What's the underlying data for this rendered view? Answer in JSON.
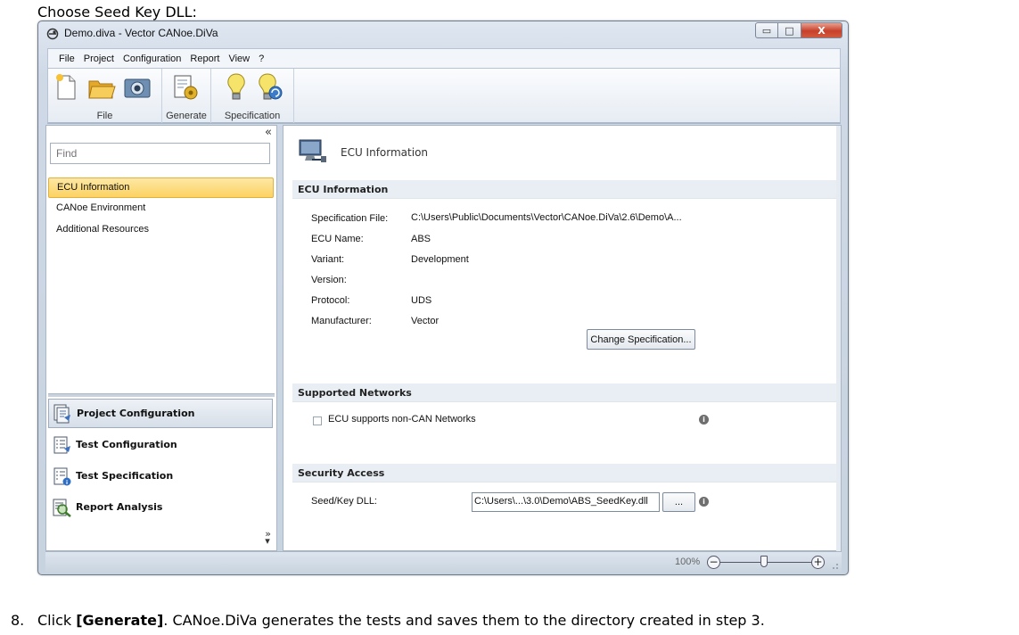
{
  "doc": {
    "heading": "Choose Seed Key DLL:",
    "step_number": "8.",
    "step_prefix": "Click ",
    "step_bold": "[Generate]",
    "step_suffix": ". CANoe.DiVa generates the tests and saves them to the directory created in step 3."
  },
  "window": {
    "title": "Demo.diva - Vector CANoe.DiVa",
    "close_glyph": "X",
    "min_glyph": "▭",
    "max_glyph": "□"
  },
  "menu": [
    "File",
    "Project",
    "Configuration",
    "Report",
    "View",
    "?"
  ],
  "ribbon": {
    "groups": [
      {
        "label": "File",
        "buttons": [
          "new-icon",
          "open-folder-icon",
          "save-camera-icon"
        ]
      },
      {
        "label": "Generate",
        "buttons": [
          "generate-icon"
        ]
      },
      {
        "label": "Specification",
        "buttons": [
          "lightbulb-icon",
          "lightbulb-refresh-icon"
        ]
      }
    ]
  },
  "left_pane": {
    "collapse_glyph": "«",
    "find_placeholder": "Find",
    "nav_items": [
      "ECU Information",
      "CANoe Environment",
      "Additional Resources"
    ],
    "selected_index": 0,
    "sections": [
      "Project Configuration",
      "Test Configuration",
      "Test Specification",
      "Report Analysis"
    ],
    "active_section_index": 0,
    "more_glyph": "»"
  },
  "right_pane": {
    "header_title": "ECU Information",
    "ecu_section_title": "ECU Information",
    "fields": [
      {
        "label": "Specification File:",
        "value": "C:\\Users\\Public\\Documents\\Vector\\CANoe.DiVa\\2.6\\Demo\\A..."
      },
      {
        "label": "ECU Name:",
        "value": "ABS"
      },
      {
        "label": "Variant:",
        "value": "Development"
      },
      {
        "label": "Version:",
        "value": ""
      },
      {
        "label": "Protocol:",
        "value": "UDS"
      },
      {
        "label": "Manufacturer:",
        "value": "Vector"
      }
    ],
    "change_spec_label": "Change Specification...",
    "networks_section_title": "Supported Networks",
    "non_can_label": "ECU supports non-CAN Networks",
    "non_can_checked": false,
    "security_section_title": "Security Access",
    "seed_label": "Seed/Key DLL:",
    "seed_value": "C:\\Users\\...\\3.0\\Demo\\ABS_SeedKey.dll",
    "browse_label": "...",
    "info_glyph": "i"
  },
  "status": {
    "zoom_label": "100%",
    "zoom_minus": "−",
    "zoom_plus": "+"
  }
}
